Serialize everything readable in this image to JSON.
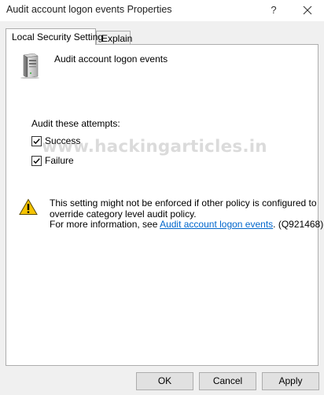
{
  "window": {
    "title": "Audit account logon events Properties",
    "help_glyph": "?",
    "close_icon": "close-icon"
  },
  "tabs": [
    {
      "label": "Local Security Setting",
      "selected": true
    },
    {
      "label": "Explain",
      "selected": false
    }
  ],
  "policy": {
    "icon": "server-icon",
    "name": "Audit account logon events"
  },
  "audit": {
    "label": "Audit these attempts:",
    "options": [
      {
        "label": "Success",
        "checked": true
      },
      {
        "label": "Failure",
        "checked": true
      }
    ]
  },
  "watermark": "www.hackingarticles.in",
  "warning": {
    "icon": "warning-icon",
    "line1": "This setting might not be enforced if other policy is configured to",
    "line2": "override category level audit policy.",
    "line3_prefix": "For more information, see ",
    "link_text": "Audit account logon events",
    "line3_suffix": ". (Q921468)"
  },
  "buttons": {
    "ok": "OK",
    "cancel": "Cancel",
    "apply": "Apply"
  },
  "colors": {
    "link": "#0066cc",
    "warning_fill": "#f5c400",
    "panel_border": "#adadad"
  }
}
